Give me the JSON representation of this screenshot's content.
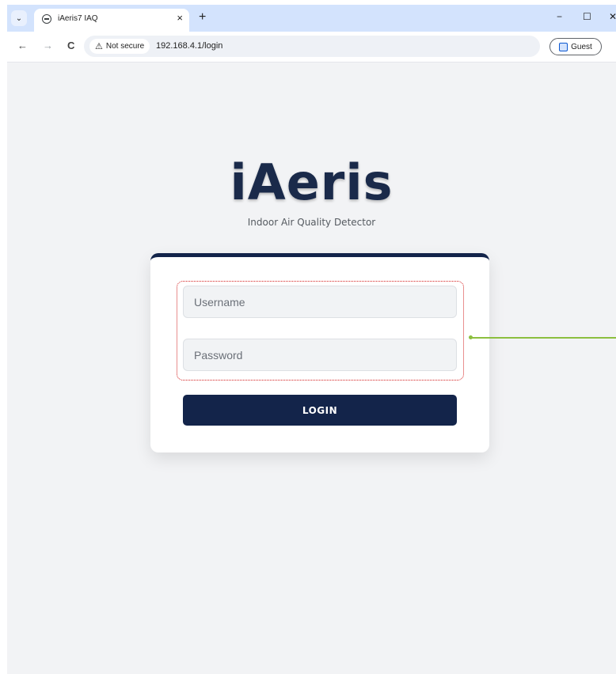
{
  "browser": {
    "tab_title": "iAeris7 IAQ",
    "tab_close": "×",
    "new_tab": "+",
    "minimize": "−",
    "maximize": "☐",
    "close": "✕",
    "back": "←",
    "forward": "→",
    "reload": "C",
    "security_chip": "Not secure",
    "security_icon": "⚠",
    "url": "192.168.4.1/login",
    "profile_label": "Guest",
    "menu": "⋮"
  },
  "page": {
    "brand": "iAeris",
    "subtitle": "Indoor Air Quality Detector"
  },
  "form": {
    "username_placeholder": "Username",
    "password_placeholder": "Password",
    "login_label": "LOGIN"
  },
  "colors": {
    "brand_navy": "#13244a",
    "annotation_red": "#d32020",
    "annotation_green": "#8cbf3f",
    "tabstrip": "#d3e3fd"
  }
}
